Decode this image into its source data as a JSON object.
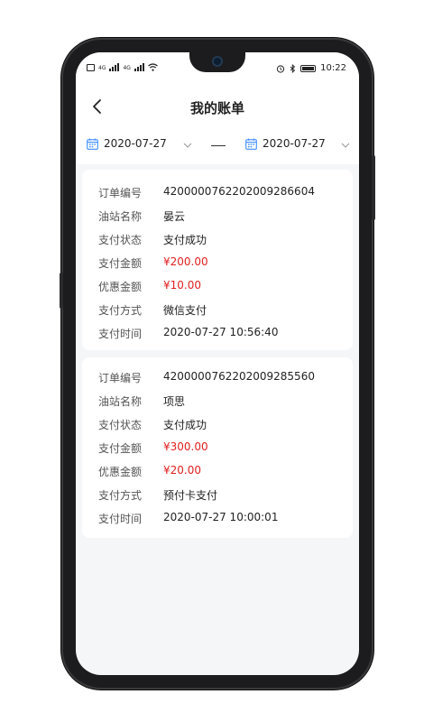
{
  "status_bar": {
    "left_icons": [
      "sim-icon",
      "wifi-icon"
    ],
    "left_net_a": "4G",
    "left_net_b": "4G",
    "time": "10:22"
  },
  "header": {
    "title": "我的账单",
    "back_icon": "chevron-left-icon"
  },
  "date_filter": {
    "start_date": "2020-07-27",
    "end_date": "2020-07-27",
    "icon": "calendar-icon",
    "accent": "#3d8bfd"
  },
  "labels": {
    "order_no": "订单编号",
    "station": "油站名称",
    "status": "支付状态",
    "amount": "支付金额",
    "discount": "优惠金额",
    "method": "支付方式",
    "time": "支付时间"
  },
  "orders": [
    {
      "order_no": "420000076220200928​6604",
      "station": "晏云",
      "status": "支付成功",
      "amount": "¥200.00",
      "discount": "¥10.00",
      "method": "微信支付",
      "time": "2020-07-27 10:56:40"
    },
    {
      "order_no": "4200000762202009285560",
      "station": "项思",
      "status": "支付成功",
      "amount": "¥300.00",
      "discount": "¥20.00",
      "method": "预付卡支付",
      "time": "2020-07-27 10:00:01"
    }
  ],
  "colors": {
    "money": "#e02020",
    "background": "#f5f6f8"
  }
}
